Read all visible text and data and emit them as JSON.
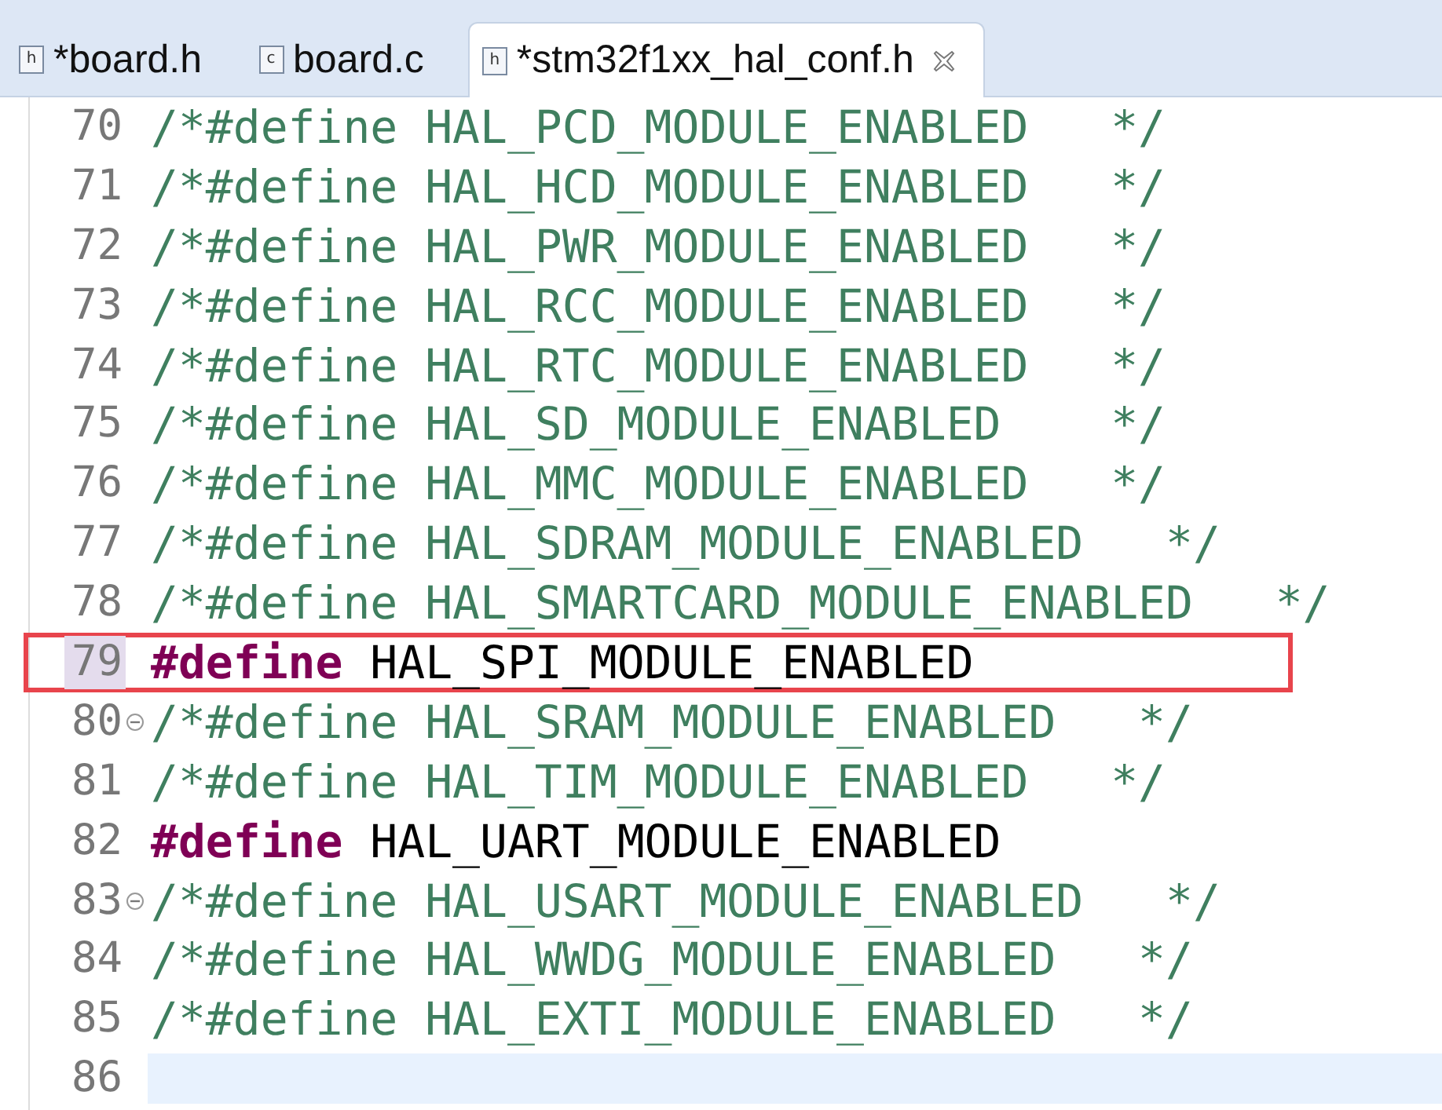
{
  "tabs": [
    {
      "icon": "h",
      "label": "*board.h",
      "selected": false,
      "closable": false
    },
    {
      "icon": "c",
      "label": "board.c",
      "selected": false,
      "closable": false
    },
    {
      "icon": "h",
      "label": "*stm32f1xx_hal_conf.h",
      "selected": true,
      "closable": true
    }
  ],
  "editor": {
    "lines": [
      {
        "number": "70",
        "kind": "comment",
        "text": "/*#define HAL_PCD_MODULE_ENABLED   */",
        "fold_marker": false,
        "highlighted": false,
        "current": false
      },
      {
        "number": "71",
        "kind": "comment",
        "text": "/*#define HAL_HCD_MODULE_ENABLED   */",
        "fold_marker": false,
        "highlighted": false,
        "current": false
      },
      {
        "number": "72",
        "kind": "comment",
        "text": "/*#define HAL_PWR_MODULE_ENABLED   */",
        "fold_marker": false,
        "highlighted": false,
        "current": false
      },
      {
        "number": "73",
        "kind": "comment",
        "text": "/*#define HAL_RCC_MODULE_ENABLED   */",
        "fold_marker": false,
        "highlighted": false,
        "current": false
      },
      {
        "number": "74",
        "kind": "comment",
        "text": "/*#define HAL_RTC_MODULE_ENABLED   */",
        "fold_marker": false,
        "highlighted": false,
        "current": false
      },
      {
        "number": "75",
        "kind": "comment",
        "text": "/*#define HAL_SD_MODULE_ENABLED    */",
        "fold_marker": false,
        "highlighted": false,
        "current": false
      },
      {
        "number": "76",
        "kind": "comment",
        "text": "/*#define HAL_MMC_MODULE_ENABLED   */",
        "fold_marker": false,
        "highlighted": false,
        "current": false
      },
      {
        "number": "77",
        "kind": "comment",
        "text": "/*#define HAL_SDRAM_MODULE_ENABLED   */",
        "fold_marker": false,
        "highlighted": false,
        "current": false
      },
      {
        "number": "78",
        "kind": "comment",
        "text": "/*#define HAL_SMARTCARD_MODULE_ENABLED   */",
        "fold_marker": false,
        "highlighted": false,
        "current": false
      },
      {
        "number": "79",
        "kind": "define",
        "keyword": "#define",
        "text": "HAL_SPI_MODULE_ENABLED",
        "fold_marker": false,
        "highlighted": true,
        "current": false
      },
      {
        "number": "80",
        "kind": "comment",
        "text": "/*#define HAL_SRAM_MODULE_ENABLED   */",
        "fold_marker": true,
        "highlighted": false,
        "current": false
      },
      {
        "number": "81",
        "kind": "comment",
        "text": "/*#define HAL_TIM_MODULE_ENABLED   */",
        "fold_marker": false,
        "highlighted": false,
        "current": false
      },
      {
        "number": "82",
        "kind": "define",
        "keyword": "#define",
        "text": "HAL_UART_MODULE_ENABLED",
        "fold_marker": false,
        "highlighted": false,
        "current": false
      },
      {
        "number": "83",
        "kind": "comment",
        "text": "/*#define HAL_USART_MODULE_ENABLED   */",
        "fold_marker": true,
        "highlighted": false,
        "current": false
      },
      {
        "number": "84",
        "kind": "comment",
        "text": "/*#define HAL_WWDG_MODULE_ENABLED   */",
        "fold_marker": false,
        "highlighted": false,
        "current": false
      },
      {
        "number": "85",
        "kind": "comment",
        "text": "/*#define HAL_EXTI_MODULE_ENABLED   */",
        "fold_marker": false,
        "highlighted": false,
        "current": false
      },
      {
        "number": "86",
        "kind": "empty",
        "fold_marker": false,
        "highlighted": false,
        "current": true
      }
    ]
  }
}
